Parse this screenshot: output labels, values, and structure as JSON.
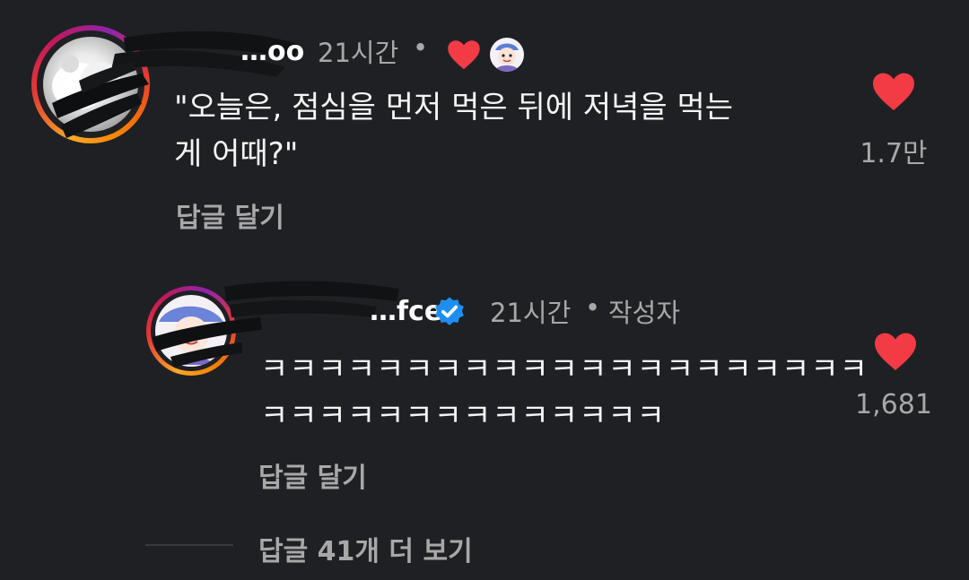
{
  "comments": [
    {
      "username": "…oo",
      "time": "21시간",
      "separator": "•",
      "text_line1": "\"오늘은, 점심을 먼저 먹은 뒤에 저녁을 먹는",
      "text_line2": "게 어때?\"",
      "reply_label": "답글 달기",
      "likes": "1.7만",
      "creator_liked": true
    },
    {
      "username": "…fce",
      "verified": true,
      "time": "21시간",
      "separator": "•",
      "author_badge": "작성자",
      "text_line1": "ㅋㅋㅋㅋㅋㅋㅋㅋㅋㅋㅋㅋㅋㅋㅋㅋㅋㅋㅋㅋㅋ",
      "text_line2": "ㅋㅋㅋㅋㅋㅋㅋㅋㅋㅋㅋㅋㅋㅋ",
      "reply_label": "답글 달기",
      "likes": "1,681"
    }
  ],
  "view_more_replies": "답글 41개 더 보기",
  "colors": {
    "background": "#1f2023",
    "heart": "#f23b45",
    "verified": "#1f8ef1",
    "muted_text": "#a8a8a8"
  },
  "icons": [
    "heart-icon",
    "verified-badge-icon",
    "creator-avatar-icon"
  ]
}
